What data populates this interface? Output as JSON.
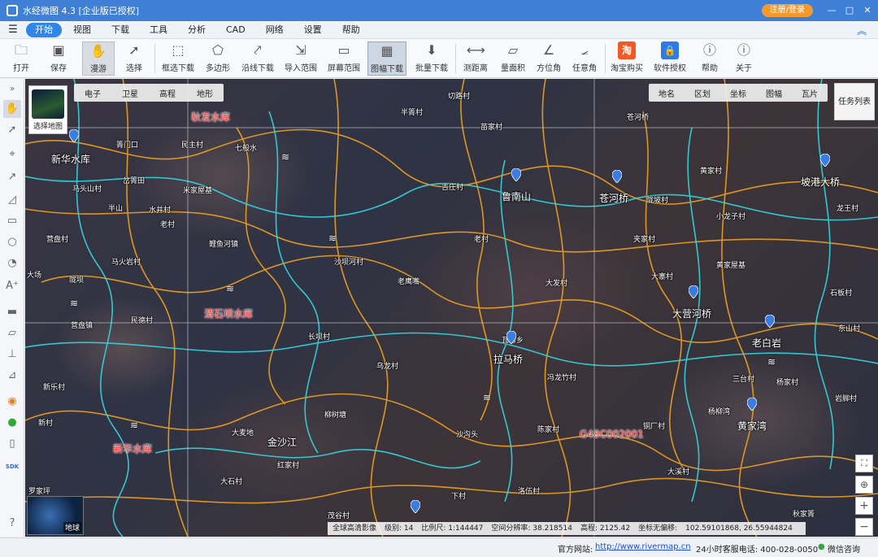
{
  "window": {
    "title": "水经微图 4.3 [企业版已授权]",
    "login_label": "注册/登录",
    "minimize": "—",
    "maximize": "□",
    "close": "✕"
  },
  "menu": {
    "items": [
      "开始",
      "视图",
      "下载",
      "工具",
      "分析",
      "CAD",
      "网络",
      "设置",
      "帮助"
    ]
  },
  "toolbar": {
    "items": [
      {
        "label": "打开",
        "icon": "folder-icon"
      },
      {
        "label": "保存",
        "icon": "save-icon"
      },
      {
        "label": "漫游",
        "icon": "hand-icon"
      },
      {
        "label": "选择",
        "icon": "cursor-icon"
      },
      {
        "label": "框选下载",
        "icon": "box-download-icon"
      },
      {
        "label": "多边形",
        "icon": "polygon-icon"
      },
      {
        "label": "沿线下载",
        "icon": "line-download-icon"
      },
      {
        "label": "导入范围",
        "icon": "import-range-icon"
      },
      {
        "label": "屏幕范围",
        "icon": "screen-range-icon"
      },
      {
        "label": "图幅下载",
        "icon": "sheet-download-icon"
      },
      {
        "label": "批量下载",
        "icon": "batch-download-icon"
      },
      {
        "label": "测距离",
        "icon": "ruler-icon"
      },
      {
        "label": "量面积",
        "icon": "area-icon"
      },
      {
        "label": "方位角",
        "icon": "azimuth-icon"
      },
      {
        "label": "任意角",
        "icon": "angle-icon"
      },
      {
        "label": "淘宝购买",
        "icon": "taobao-icon",
        "glyph": "淘"
      },
      {
        "label": "软件授权",
        "icon": "license-icon"
      },
      {
        "label": "帮助",
        "icon": "help-icon"
      },
      {
        "label": "关于",
        "icon": "info-icon"
      }
    ]
  },
  "map": {
    "thumbnail_label": "选择地图",
    "types": [
      "电子",
      "卫星",
      "高程",
      "地形"
    ],
    "layers": [
      "地名",
      "区划",
      "坐标",
      "图幅",
      "瓦片"
    ],
    "task_list": "任务列表",
    "globe_label": "地球",
    "place_labels": [
      "新华水库",
      "箐门口",
      "民主村",
      "七般水",
      "马头山村",
      "岔箐田",
      "米家屋基",
      "半山",
      "老村",
      "鲤鱼河镇",
      "半箐村",
      "切路村",
      "营盘村",
      "大场",
      "马火岩村",
      "陇坝",
      "营盘镇",
      "沙坝河村",
      "民德村",
      "老鹰嘴",
      "长坝村",
      "新乐村",
      "大麦地",
      "柳树塘",
      "红家村",
      "大石村",
      "茂谷村",
      "乌龙村",
      "吉庄村",
      "沙沟头",
      "瓦房乡",
      "陈家村",
      "老村",
      "冯龙竹村",
      "苍河桥",
      "大发村",
      "大寨村",
      "黄家屋基",
      "小龙子村",
      "夹家村",
      "陇坡村",
      "三台村",
      "杨家村",
      "岩脚村",
      "铜厂村",
      "洛伍村",
      "下村",
      "秋家箐",
      "大溪村",
      "罗家坪",
      "苗家村",
      "水井村",
      "龙王村",
      "石板村",
      "新村",
      "东山村",
      "杨柳湾",
      "黄家村"
    ],
    "big_labels": [
      "鲁南山",
      "苍河桥",
      "坡港大桥",
      "大营河桥",
      "老白岩",
      "拉马桥",
      "黄家湾",
      "金沙江"
    ],
    "red_labels": [
      "秋发水库",
      "渭石坝水库",
      "新华水库",
      "G48C002001"
    ],
    "status": {
      "source": "全球高清影像",
      "level": "级别: 14",
      "scale": "比例尺: 1:144447",
      "resolution": "空间分辨率: 38.218514",
      "elevation": "高程:   2125.42",
      "coord_label": "坐标无偏移:",
      "coord": "102.59101868, 26.55944824"
    }
  },
  "statusbar": {
    "site_label": "官方网站:",
    "site_url": "http://www.rivermap.cn",
    "phone": "24小时客服电话: 400-028-0050",
    "wechat": "微信咨询"
  }
}
